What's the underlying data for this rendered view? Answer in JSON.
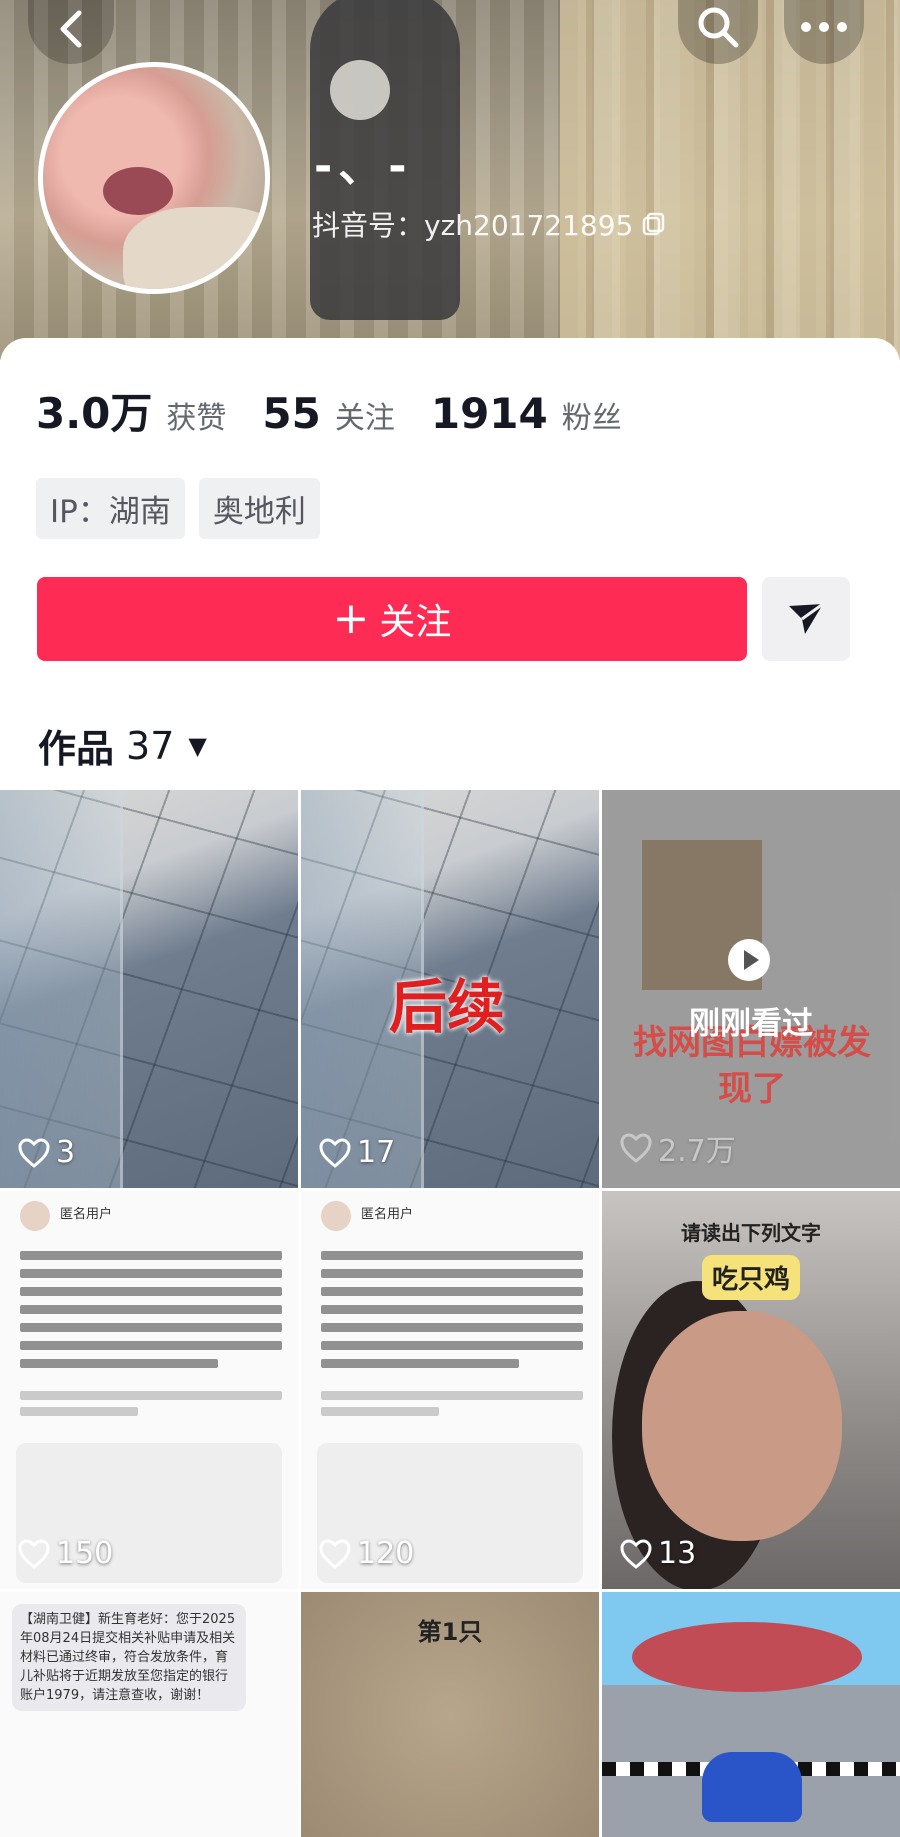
{
  "profile": {
    "nickname": "-、-",
    "douyin_id": "抖音号：yzh201721895"
  },
  "stats": [
    {
      "value": "3.0万",
      "label": "获赞"
    },
    {
      "value": "55",
      "label": "关注"
    },
    {
      "value": "1914",
      "label": "粉丝"
    }
  ],
  "tags": [
    "IP：湖南",
    "奥地利"
  ],
  "actions": {
    "follow_plus": "+",
    "follow_label": "关注"
  },
  "works": {
    "label": "作品",
    "count": "37",
    "caret": "▼"
  },
  "videos": [
    {
      "likes": "3"
    },
    {
      "likes": "17",
      "overlay": "后续"
    },
    {
      "likes": "2.7万",
      "overlay": "找网图白嫖被发现了",
      "status": "刚刚看过"
    },
    {
      "likes": "150",
      "header": "匿名用户"
    },
    {
      "likes": "120",
      "header": "匿名用户"
    },
    {
      "likes": "13",
      "top_text": "请读出下列文字",
      "bubble": "吃只鸡"
    },
    {
      "notice": "【湖南卫健】新生育老好：您于2025年08月24日提交相关补贴申请及相关材料已通过终审，符合发放条件，育儿补贴将于近期发放至您指定的银行账户1979，请注意查收，谢谢！"
    },
    {
      "overlay": "第1只"
    },
    {}
  ],
  "colors": {
    "accent": "#fe2c55",
    "text": "#161823",
    "muted": "#666870"
  }
}
